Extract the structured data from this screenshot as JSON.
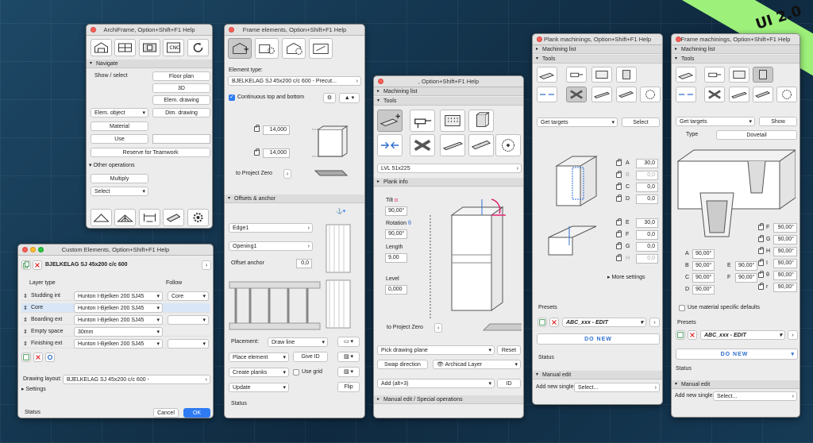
{
  "badge": "UI 2.0",
  "archiframe": {
    "title": "ArchiFrame, Option+Shift+F1 Help",
    "navigate": "Navigate",
    "show_select": "Show / select",
    "floor_plan": "Floor plan",
    "view3d": "3D",
    "elem_drawing": "Elem. drawing",
    "elem_object": "Elem. object",
    "dim_drawing": "Dim. drawing",
    "material": "Material",
    "use": "Use",
    "reserve": "Reserve for Teamwork",
    "other_ops": "Other operations",
    "multiply": "Multiply",
    "select": "Select"
  },
  "custom": {
    "title": "Custom Elements, Option+Shift+F1 Help",
    "name": "BJELKELAG SJ 45x200 c/c 600",
    "layer_type": "Layer type",
    "follow": "Follow",
    "layers": [
      {
        "type": "Studding int",
        "material": "Hunton I-Bjelken 200 SJ45",
        "follow": "Core"
      },
      {
        "type": "Core",
        "material": "Hunton I-Bjelken 200 SJ45",
        "follow": ""
      },
      {
        "type": "Boarding ext",
        "material": "Hunton I-Bjelken 200 SJ45",
        "follow": ""
      },
      {
        "type": "Empty space",
        "material": "30mm",
        "follow": ""
      },
      {
        "type": "Finishing ext",
        "material": "Hunton I-Bjelken 200 SJ45",
        "follow": ""
      }
    ],
    "drawing_layout_label": "Drawing layout:",
    "drawing_layout": "BJELKELAG SJ 45x200 c/c 600 -",
    "settings": "Settings",
    "status": "Status",
    "cancel": "Cancel",
    "ok": "OK"
  },
  "frame": {
    "title": "Frame elements, Option+Shift+F1 Help",
    "element_type_label": "Element type:",
    "element_type": "BJELKELAG SJ 45x200 c/c 600 - Precut...",
    "continuous": "Continuous top and bottom",
    "dim1": "14,000",
    "dim2": "14,000",
    "to_project_zero": "to Project Zero",
    "offsets_anchor": "Offsets & anchor",
    "edge": "Edge1",
    "opening": "Opening1",
    "offset_anchor_label": "Offset anchor",
    "offset_anchor_value": "0,0",
    "placement_label": "Placement:",
    "placement": "Draw line",
    "place_element": "Place element",
    "give_id": "Give ID",
    "create_planks": "Create planks",
    "use_grid": "Use grid",
    "update": "Update",
    "flip": "Flip",
    "status": "Status"
  },
  "machining": {
    "title": ", Option+Shift+F1 Help",
    "machining_list": "Machining list",
    "tools": "Tools",
    "lvl": "LVL 51x225",
    "plank_info": "Plank info",
    "tilt_label": "Tilt",
    "tilt_symbol": "α",
    "tilt": "90,00°",
    "rotation_label": "Rotation",
    "rotation_symbol": "θ",
    "rotation": "90,00°",
    "length_label": "Length",
    "length": "9,00",
    "level_label": "Level",
    "level": "0,000",
    "to_project_zero": "to Project Zero",
    "pick_plane": "Pick drawing plane",
    "reset": "Reset",
    "swap_direction": "Swap direction",
    "archicad_layer": "Archicad Layer",
    "add": "Add (alt+3)",
    "id": "ID",
    "manual_edit": "Manual edit / Special operations"
  },
  "plank": {
    "title": "Plank machinings, Option+Shift+F1 Help",
    "machining_list": "Machining list",
    "tools": "Tools",
    "get_targets": "Get targets",
    "select": "Select",
    "params": [
      {
        "k": "A",
        "v": "30,0"
      },
      {
        "k": "B",
        "v": "0,0"
      },
      {
        "k": "C",
        "v": "0,0"
      },
      {
        "k": "D",
        "v": "0,0"
      },
      {
        "k": "E",
        "v": "30,0"
      },
      {
        "k": "F",
        "v": "0,0"
      },
      {
        "k": "G",
        "v": "0,0"
      },
      {
        "k": "H",
        "v": "0,0"
      }
    ],
    "more_settings": "More settings",
    "presets": "Presets",
    "preset": "ABC_xxx - EDIT",
    "do_new": "DO NEW",
    "status": "Status",
    "manual_edit": "Manual edit",
    "add_new_single": "Add new single:",
    "select_placeholder": "Select..."
  },
  "framemach": {
    "title": "Frame machinings, Option+Shift+F1 Help",
    "machining_list": "Machining list",
    "tools": "Tools",
    "get_targets": "Get targets",
    "show": "Show",
    "type_label": "Type",
    "type": "Dovetail",
    "left": [
      {
        "k": "A",
        "v": "90,00°"
      },
      {
        "k": "B",
        "v": "90,00°"
      },
      {
        "k": "C",
        "v": "90,00°"
      },
      {
        "k": "D",
        "v": "90,00°"
      }
    ],
    "mid": [
      {
        "k": "E",
        "v": "90,00°"
      },
      {
        "k": "F",
        "v": "90,00°"
      }
    ],
    "right": [
      {
        "k": "F",
        "v": "90,00°"
      },
      {
        "k": "G",
        "v": "90,00°"
      },
      {
        "k": "H",
        "v": "90,00°"
      },
      {
        "k": "I",
        "v": "90,00°"
      },
      {
        "k": "θ",
        "v": "90,00°"
      },
      {
        "k": "r",
        "v": "90,00°"
      }
    ],
    "material_defaults": "Use material specific defaults",
    "presets": "Presets",
    "preset": "ABC_xxx - EDIT",
    "do_new": "DO NEW",
    "status": "Status",
    "manual_edit": "Manual edit",
    "add_new_single": "Add new single:",
    "select_placeholder": "Select..."
  }
}
